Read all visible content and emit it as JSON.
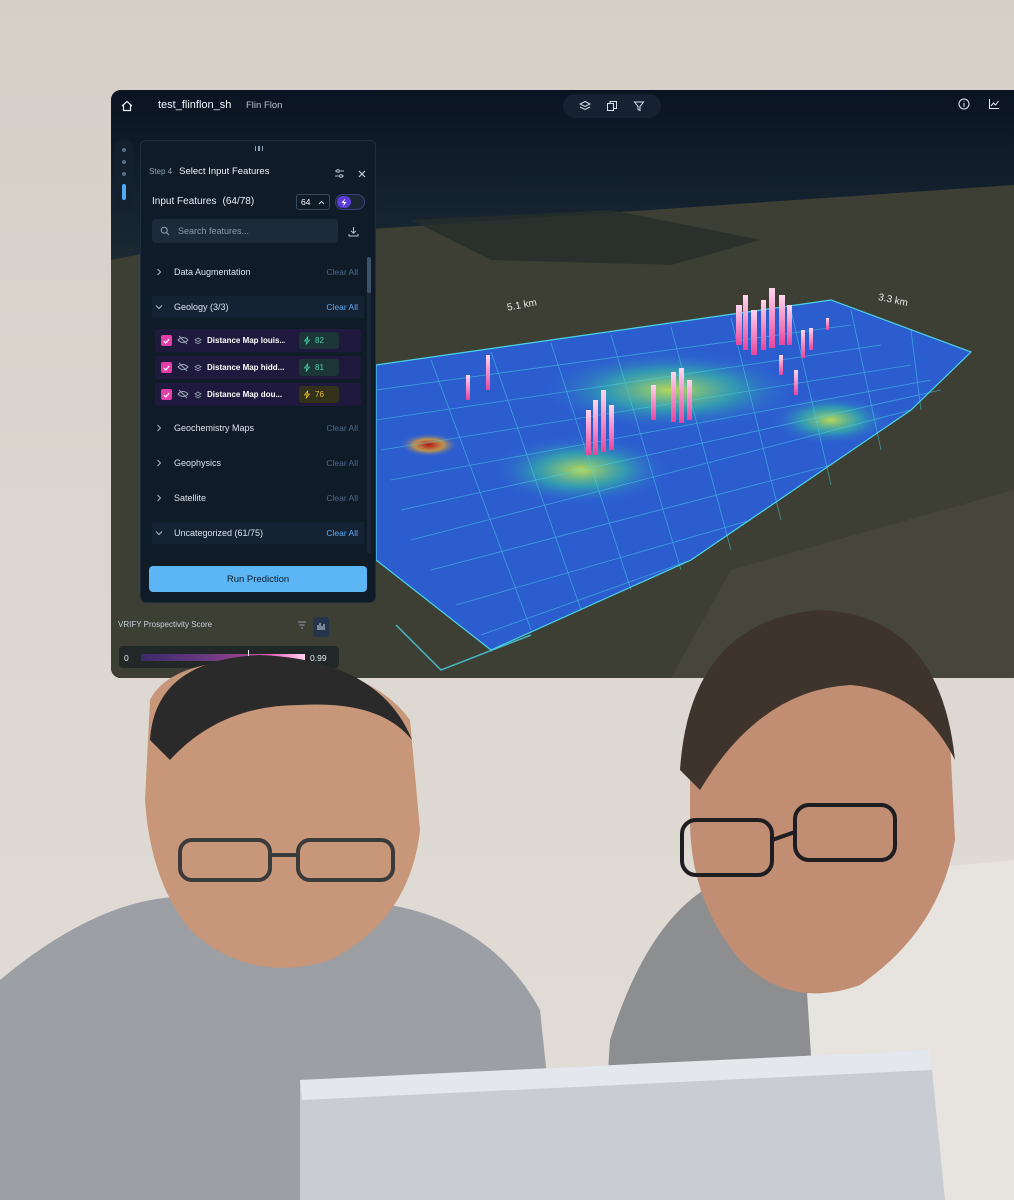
{
  "topbar": {
    "project_title": "test_flinflon_sh",
    "project_location": "Flin Flon",
    "icons": [
      "home-icon",
      "layers-icon",
      "copy-icon",
      "filter-icon",
      "info-icon",
      "chart-icon"
    ]
  },
  "panel": {
    "step_label": "Step 4",
    "step_title": "Select Input Features",
    "input_features_label": "Input Features",
    "input_features_count": "(64/78)",
    "count_value": "64",
    "search_placeholder": "Search features...",
    "categories": [
      {
        "name": "Data Augmentation",
        "clear": "Clear All",
        "expanded": false
      },
      {
        "name": "Geology (3/3)",
        "clear": "Clear All",
        "expanded": true
      },
      {
        "name": "Geochemistry Maps",
        "clear": "Clear All",
        "expanded": false
      },
      {
        "name": "Geophysics",
        "clear": "Clear All",
        "expanded": false
      },
      {
        "name": "Satellite",
        "clear": "Clear All",
        "expanded": false
      },
      {
        "name": "Uncategorized (61/75)",
        "clear": "Clear All",
        "expanded": true
      }
    ],
    "features": [
      {
        "name": "Distance Map louis...",
        "score": "82",
        "score_color": "#4ad0b0"
      },
      {
        "name": "Distance Map hidd...",
        "score": "81",
        "score_color": "#4ad0b0"
      },
      {
        "name": "Distance Map dou...",
        "score": "76",
        "score_color": "#e6c234"
      }
    ],
    "run_button": "Run Prediction"
  },
  "legend": {
    "title": "VRIFY Prospectivity Score",
    "min": "0",
    "max": "0.99"
  },
  "map_labels": {
    "distance_a": "5.1 km",
    "distance_b": "3.3 km"
  },
  "colors": {
    "accent": "#5cb6f5",
    "checkbox": "#e43fa8",
    "toggle": "#5b3ed6",
    "panel_bg": "#101b28"
  }
}
